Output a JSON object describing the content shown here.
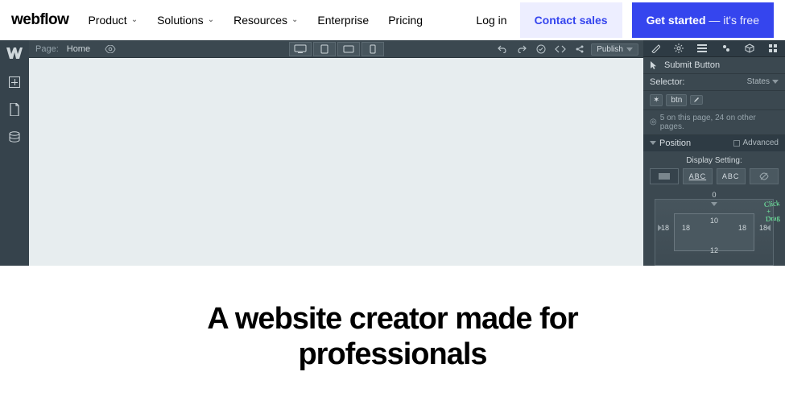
{
  "nav": {
    "logo": "webflow",
    "items": [
      "Product",
      "Solutions",
      "Resources",
      "Enterprise",
      "Pricing"
    ],
    "has_dropdown": [
      true,
      true,
      true,
      false,
      false
    ],
    "login": "Log in",
    "contact": "Contact sales",
    "cta_main": "Get started",
    "cta_suffix": " — it's free"
  },
  "designer": {
    "breadcrumb_label": "Page:",
    "breadcrumb_page": "Home",
    "publish_label": "Publish",
    "right_panel": {
      "selected_element": "Submit Button",
      "selector_label": "Selector:",
      "states_label": "States",
      "tag": "btn",
      "occurrence_note": "5 on this page, 24 on other pages.",
      "position_section": "Position",
      "advanced_label": "Advanced",
      "display_setting_label": "Display Setting:",
      "display_option_abc": "ABC",
      "box_model": {
        "margin_top": "0",
        "margin_left": "18",
        "margin_right": "18",
        "padding_top": "10",
        "padding_left": "18",
        "padding_right": "18",
        "padding_bottom": "12"
      },
      "hint_line1": "Click",
      "hint_line2": "Drag"
    }
  },
  "hero": {
    "headline": "A website creator made for professionals"
  }
}
